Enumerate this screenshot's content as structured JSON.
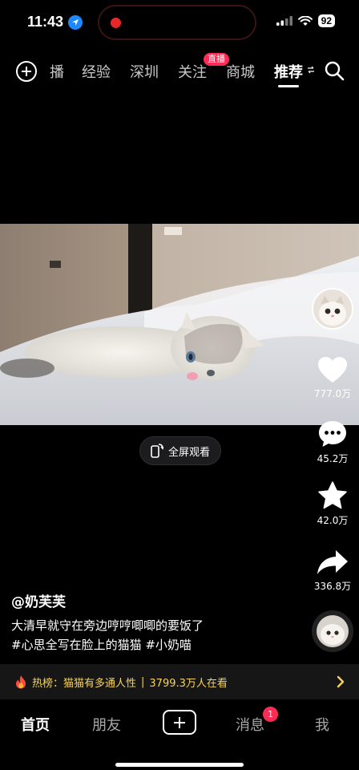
{
  "status_bar": {
    "time": "11:43",
    "battery": "92",
    "icons": [
      "location-arrow-icon",
      "signal-icon",
      "wifi-icon",
      "battery-icon"
    ],
    "recording_color": "#e82828"
  },
  "top_nav": {
    "tabs": [
      {
        "label": "播",
        "active": false
      },
      {
        "label": "经验",
        "active": false
      },
      {
        "label": "深圳",
        "active": false
      },
      {
        "label": "关注",
        "active": false
      },
      {
        "label": "商城",
        "active": false
      },
      {
        "label": "推荐",
        "active": true
      }
    ],
    "live_badge": "直播"
  },
  "video": {
    "fullscreen_label": "全屏观看"
  },
  "actions": {
    "likes": "777.0万",
    "comments": "45.2万",
    "favorites": "42.0万",
    "shares": "336.8万"
  },
  "caption": {
    "author": "@奶芙芙",
    "description": "大清早就守在旁边哼哼唧唧的要饭了",
    "hashtags": "#心思全写在脸上的猫猫 #小奶喵"
  },
  "hot_bar": {
    "label": "热榜：猫猫有多通人性",
    "separator": "|",
    "viewers": "3799.3万人在看"
  },
  "tab_bar": {
    "home": "首页",
    "friends": "朋友",
    "messages": "消息",
    "messages_badge": "1",
    "me": "我"
  },
  "colors": {
    "accent": "#fe2c55",
    "hot_text": "#f7d25a",
    "location_blue": "#1e88ff"
  }
}
